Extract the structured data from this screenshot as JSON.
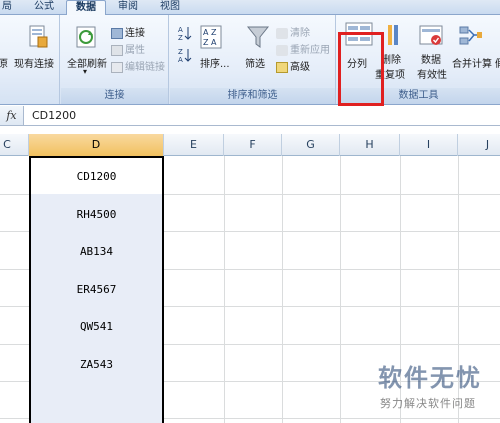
{
  "tabs": [
    {
      "label": "局",
      "active": false
    },
    {
      "label": "公式",
      "active": false
    },
    {
      "label": "数据",
      "active": true
    },
    {
      "label": "审阅",
      "active": false
    },
    {
      "label": "视图",
      "active": false
    }
  ],
  "ribbon": {
    "get_external": {
      "btn_existing_partial": "原",
      "btn_existing_connections": "现有连接"
    },
    "connections": {
      "label": "连接",
      "refresh_all": "全部刷新",
      "connections": "连接",
      "properties": "属性",
      "edit_links": "编辑链接"
    },
    "sort_filter": {
      "label": "排序和筛选",
      "sort": "排序...",
      "filter": "筛选",
      "clear": "清除",
      "reapply": "重新应用",
      "advanced": "高级"
    },
    "data_tools": {
      "label": "数据工具",
      "text_to_columns": "分列",
      "remove_duplicates_1": "删除",
      "remove_duplicates_2": "重复项",
      "validation_1": "数据",
      "validation_2": "有效性",
      "consolidate": "合并计算",
      "whatif_partial": "假"
    }
  },
  "formula_bar": {
    "fx": "fx",
    "value": "CD1200"
  },
  "columns": [
    "C",
    "D",
    "E",
    "F",
    "G",
    "H",
    "I",
    "J"
  ],
  "selected_column": "D",
  "cells": [
    "CD1200",
    "RH4500",
    "AB134",
    "ER4567",
    "QW541",
    "ZA543"
  ],
  "watermark": {
    "title": "软件无忧",
    "subtitle": "努力解决软件问题"
  },
  "colors": {
    "highlight_box": "#e02020",
    "selected_column_bg": "#e8edf7",
    "selected_header": "#f1c15f"
  }
}
